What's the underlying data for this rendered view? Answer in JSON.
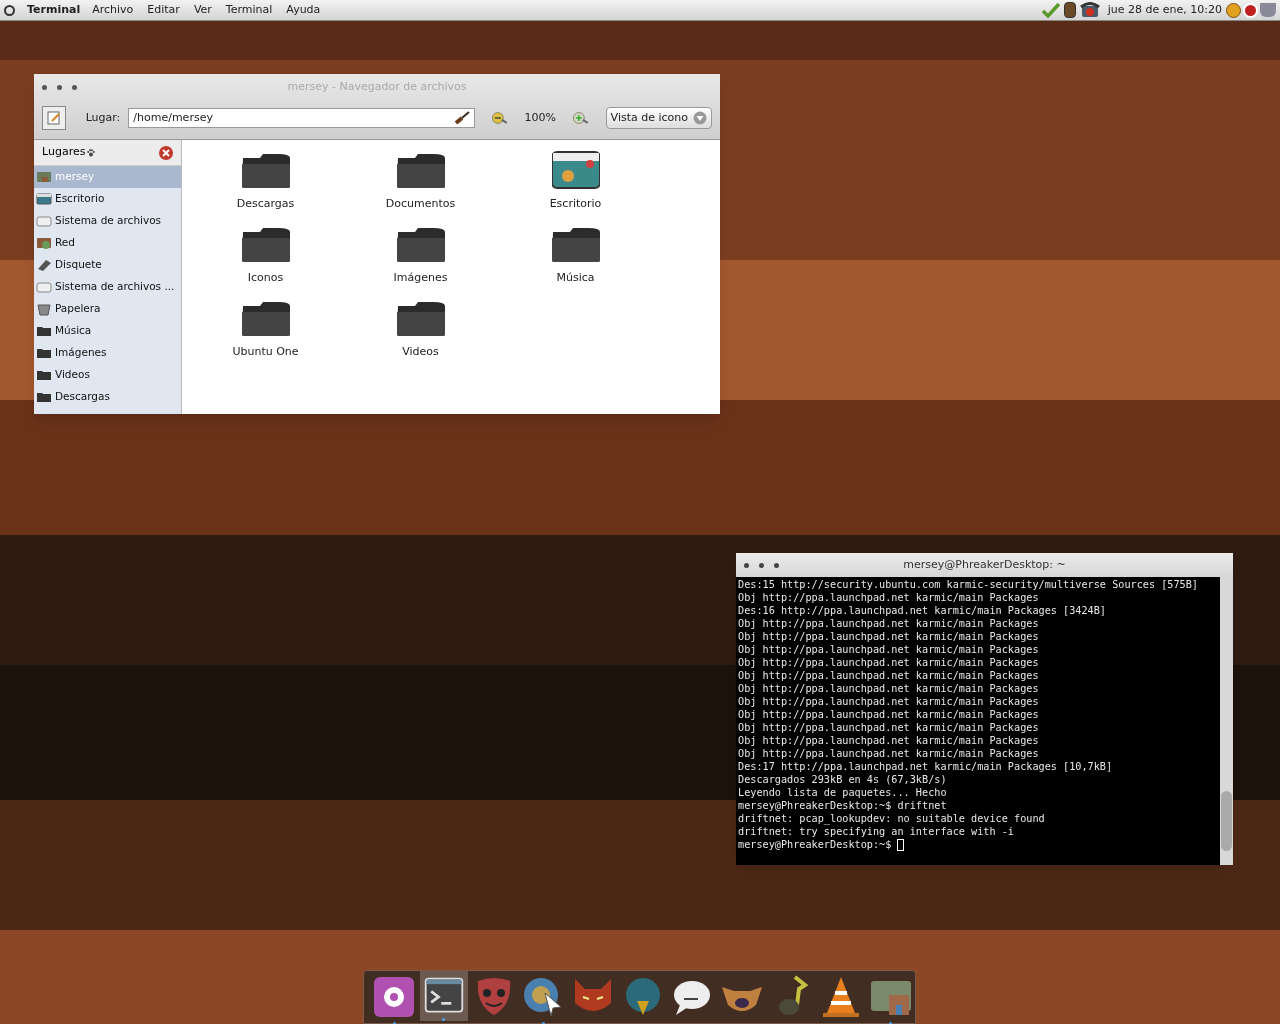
{
  "top_panel": {
    "app_name": "Terminal",
    "menus": [
      "Archivo",
      "Editar",
      "Ver",
      "Terminal",
      "Ayuda"
    ],
    "clock": "jue 28 de ene, 10:20"
  },
  "file_manager": {
    "title": "mersey - Navegador de archivos",
    "location_label": "Lugar:",
    "location": "/home/mersey",
    "zoom": "100%",
    "view": "Vista de icono",
    "sidebar": {
      "heading": "Lugares",
      "items": [
        {
          "label": "mersey",
          "kind": "home",
          "selected": true
        },
        {
          "label": "Escritorio",
          "kind": "desktop",
          "selected": false
        },
        {
          "label": "Sistema de archivos",
          "kind": "drive",
          "selected": false
        },
        {
          "label": "Red",
          "kind": "network",
          "selected": false
        },
        {
          "label": "Disquete",
          "kind": "floppy",
          "selected": false
        },
        {
          "label": "Sistema de archivos ...",
          "kind": "drive",
          "selected": false
        },
        {
          "label": "Papelera",
          "kind": "trash",
          "selected": false
        },
        {
          "label": "Música",
          "kind": "folder",
          "selected": false
        },
        {
          "label": "Imágenes",
          "kind": "folder",
          "selected": false
        },
        {
          "label": "Videos",
          "kind": "folder",
          "selected": false
        },
        {
          "label": "Descargas",
          "kind": "folder",
          "selected": false
        }
      ]
    },
    "files": [
      {
        "label": "Descargas",
        "kind": "folder"
      },
      {
        "label": "Documentos",
        "kind": "folder"
      },
      {
        "label": "Escritorio",
        "kind": "desktop"
      },
      {
        "label": "Iconos",
        "kind": "folder"
      },
      {
        "label": "Imágenes",
        "kind": "folder"
      },
      {
        "label": "Música",
        "kind": "folder"
      },
      {
        "label": "Ubuntu One",
        "kind": "folder"
      },
      {
        "label": "Videos",
        "kind": "folder"
      }
    ]
  },
  "terminal": {
    "title": "mersey@PhreakerDesktop: ~",
    "lines": [
      "Des:15 http://security.ubuntu.com karmic-security/multiverse Sources [575B]",
      "Obj http://ppa.launchpad.net karmic/main Packages",
      "Des:16 http://ppa.launchpad.net karmic/main Packages [3424B]",
      "Obj http://ppa.launchpad.net karmic/main Packages",
      "Obj http://ppa.launchpad.net karmic/main Packages",
      "Obj http://ppa.launchpad.net karmic/main Packages",
      "Obj http://ppa.launchpad.net karmic/main Packages",
      "Obj http://ppa.launchpad.net karmic/main Packages",
      "Obj http://ppa.launchpad.net karmic/main Packages",
      "Obj http://ppa.launchpad.net karmic/main Packages",
      "Obj http://ppa.launchpad.net karmic/main Packages",
      "Obj http://ppa.launchpad.net karmic/main Packages",
      "Obj http://ppa.launchpad.net karmic/main Packages",
      "Obj http://ppa.launchpad.net karmic/main Packages",
      "Des:17 http://ppa.launchpad.net karmic/main Packages [10,7kB]",
      "Descargados 293kB en 4s (67,3kB/s)",
      "Leyendo lista de paquetes... Hecho",
      "mersey@PhreakerDesktop:~$ driftnet",
      "driftnet: pcap_lookupdev: no suitable device found",
      "driftnet: try specifying an interface with -i",
      "mersey@PhreakerDesktop:~$"
    ]
  },
  "dock": [
    {
      "kind": "settings",
      "running": true,
      "selected": false
    },
    {
      "kind": "terminal",
      "running": true,
      "selected": true
    },
    {
      "kind": "mask",
      "running": false,
      "selected": false
    },
    {
      "kind": "globe",
      "running": true,
      "selected": false
    },
    {
      "kind": "fox",
      "running": false,
      "selected": false
    },
    {
      "kind": "bird",
      "running": false,
      "selected": false
    },
    {
      "kind": "chat",
      "running": false,
      "selected": false
    },
    {
      "kind": "creature",
      "running": false,
      "selected": false
    },
    {
      "kind": "note",
      "running": false,
      "selected": false
    },
    {
      "kind": "cone",
      "running": false,
      "selected": false
    },
    {
      "kind": "home",
      "running": true,
      "selected": false
    }
  ]
}
